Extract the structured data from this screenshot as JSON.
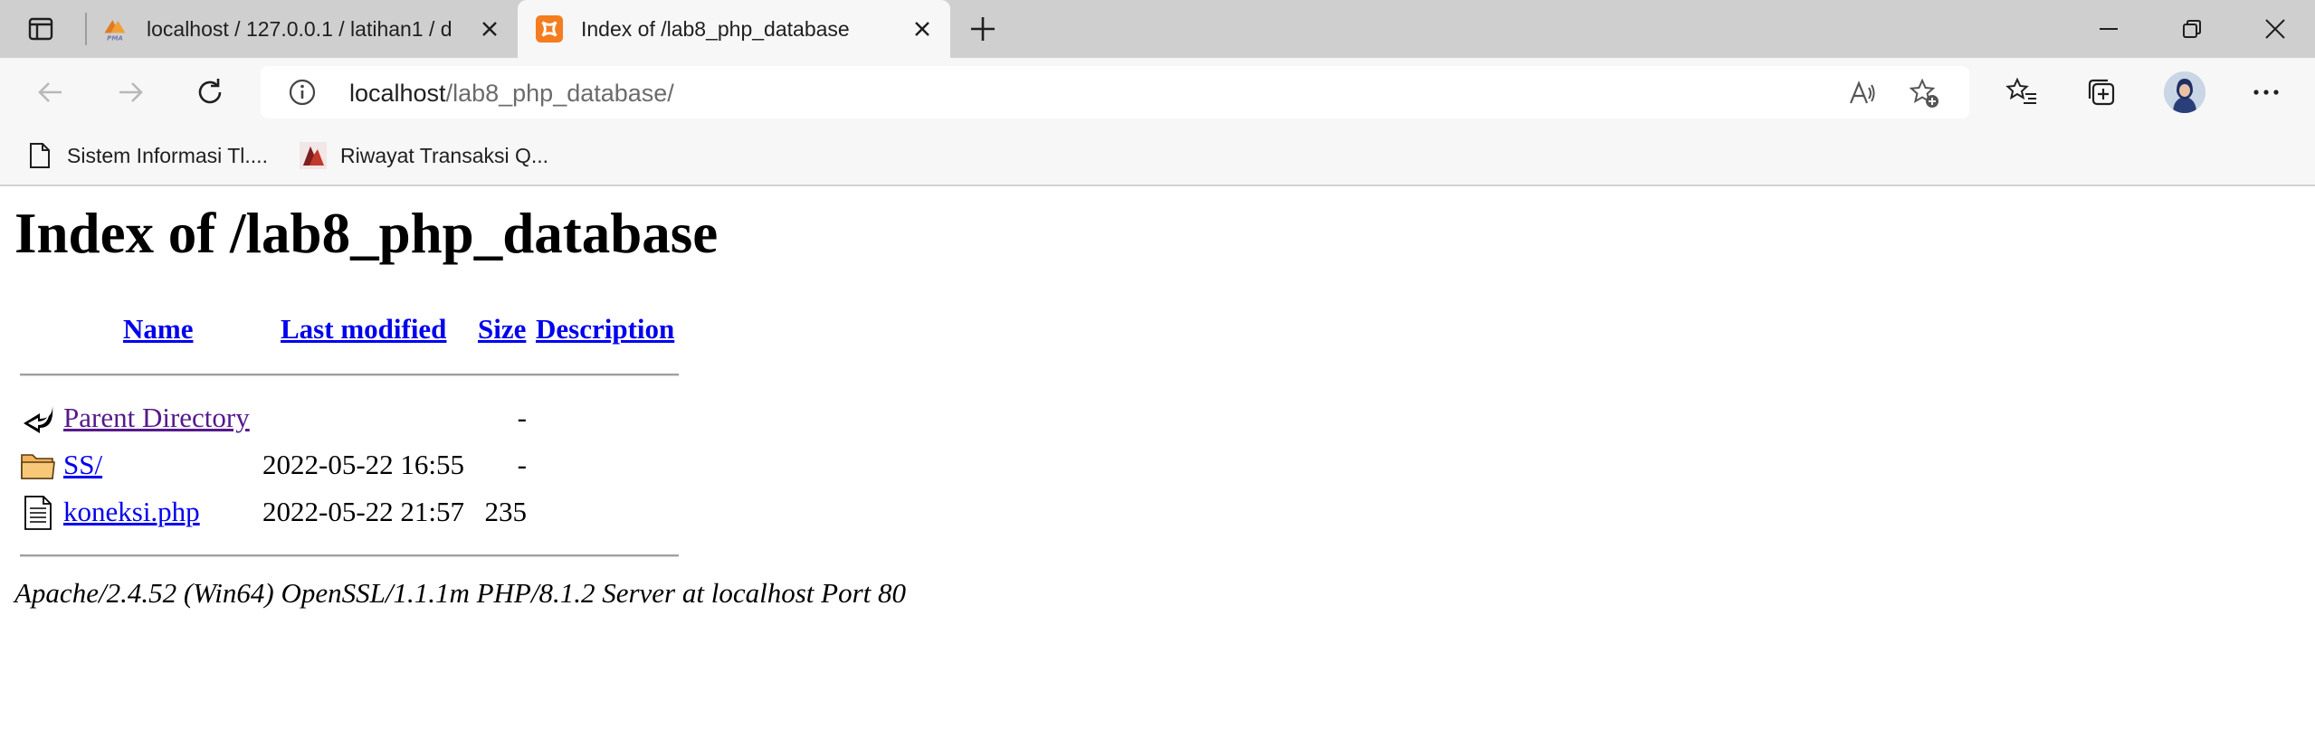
{
  "browser": {
    "tabs": [
      {
        "title": "localhost / 127.0.0.1 / latihan1 / d",
        "favicon": "phpmyadmin-icon",
        "active": false
      },
      {
        "title": "Index of /lab8_php_database",
        "favicon": "xampp-icon",
        "active": true
      }
    ],
    "address_bar": {
      "host": "localhost",
      "path": "/lab8_php_database/"
    },
    "bookmarks": [
      {
        "label": "Sistem Informasi Tl....",
        "icon": "page-icon"
      },
      {
        "label": "Riwayat Transaksi Q...",
        "icon": "site-logo-icon"
      }
    ],
    "colors": {
      "tabstrip": "#cfcfcf",
      "toolbar": "#f7f7f7",
      "xampp_orange": "#f57c1f"
    }
  },
  "page": {
    "heading": "Index of /lab8_php_database",
    "columns": {
      "name": "Name",
      "last_modified": "Last modified",
      "size": "Size",
      "description": "Description"
    },
    "rows": [
      {
        "name": "Parent Directory",
        "modified": "",
        "size": "-",
        "icon": "back-arrow-icon"
      },
      {
        "name": "SS/",
        "modified": "2022-05-22 16:55",
        "size": "-",
        "icon": "folder-icon"
      },
      {
        "name": "koneksi.php",
        "modified": "2022-05-22 21:57",
        "size": "235",
        "icon": "text-file-icon"
      }
    ],
    "server_signature": "Apache/2.4.52 (Win64) OpenSSL/1.1.1m PHP/8.1.2 Server at localhost Port 80"
  }
}
